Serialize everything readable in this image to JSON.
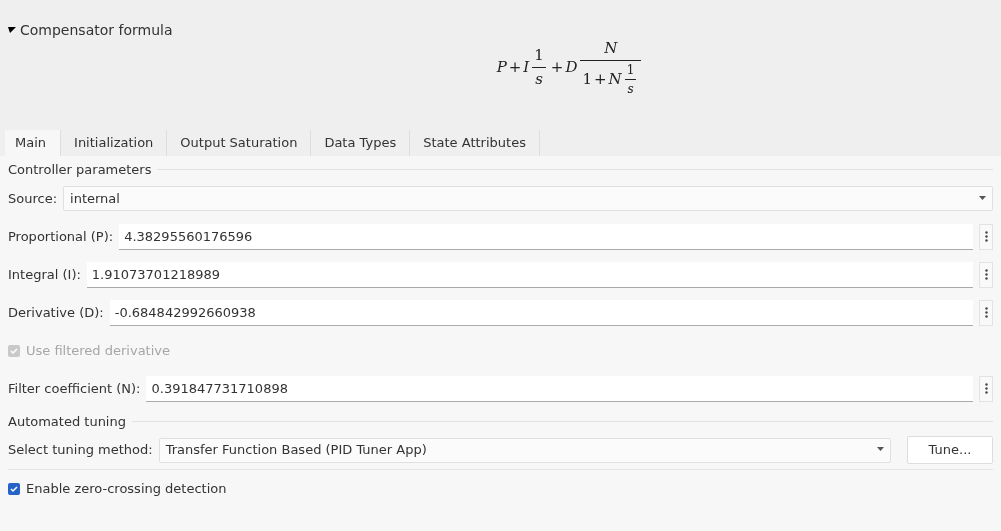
{
  "section": {
    "title": "Compensator formula",
    "expanded": true,
    "formula": [
      {
        "kind": "sym",
        "text": "P"
      },
      {
        "kind": "op",
        "text": "+"
      },
      {
        "kind": "sym",
        "text": "I"
      },
      {
        "kind": "frac",
        "num": [
          {
            "kind": "num",
            "text": "1"
          }
        ],
        "den": [
          {
            "kind": "sym",
            "text": "s"
          }
        ]
      },
      {
        "kind": "op",
        "text": "+"
      },
      {
        "kind": "sym",
        "text": "D"
      },
      {
        "kind": "frac",
        "num": [
          {
            "kind": "sym",
            "text": "N"
          }
        ],
        "den": [
          {
            "kind": "num",
            "text": "1"
          },
          {
            "kind": "op",
            "text": "+"
          },
          {
            "kind": "sym",
            "text": "N"
          },
          {
            "kind": "frac",
            "num": [
              {
                "kind": "num",
                "text": "1"
              }
            ],
            "den": [
              {
                "kind": "sym",
                "text": "s"
              }
            ]
          }
        ]
      }
    ]
  },
  "tabs": [
    {
      "label": "Main",
      "selected": true
    },
    {
      "label": "Initialization",
      "selected": false
    },
    {
      "label": "Output Saturation",
      "selected": false
    },
    {
      "label": "Data Types",
      "selected": false
    },
    {
      "label": "State Attributes",
      "selected": false
    }
  ],
  "groups": [
    {
      "title": "Controller parameters",
      "rows": [
        {
          "kind": "dropdown",
          "label": "Source:",
          "value": "internal"
        },
        {
          "kind": "number",
          "label": "Proportional (P):",
          "value": "4.38295560176596"
        },
        {
          "kind": "number",
          "label": "Integral (I):",
          "value": "1.91073701218989"
        },
        {
          "kind": "number",
          "label": "Derivative (D):",
          "value": "-0.684842992660938"
        },
        {
          "kind": "checkbox",
          "label": "Use filtered derivative",
          "checked": true,
          "disabled": true
        },
        {
          "kind": "number",
          "label": "Filter coefficient (N):",
          "value": "0.391847731710898"
        }
      ]
    },
    {
      "title": "Automated tuning",
      "rows": [
        {
          "kind": "dropdown",
          "label": "Select tuning method:",
          "value": "Transfer Function Based (PID Tuner App)",
          "button": "Tune..."
        }
      ]
    }
  ],
  "options": [
    {
      "kind": "checkbox",
      "label": "Enable zero-crossing detection",
      "checked": true,
      "disabled": false
    }
  ]
}
